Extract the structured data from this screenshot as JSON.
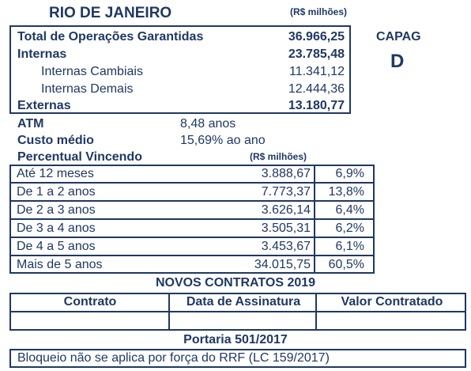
{
  "header": {
    "title": "RIO DE JANEIRO",
    "unit": "(R$ milhões)"
  },
  "summary": {
    "rows": [
      {
        "label": "Total de Operações Garantidas",
        "value": "36.966,25"
      },
      {
        "label": "Internas",
        "value": "23.785,48"
      },
      {
        "label": "Internas Cambiais",
        "value": "11.341,12"
      },
      {
        "label": "Internas Demais",
        "value": "12.444,36"
      },
      {
        "label": "Externas",
        "value": "13.180,77"
      }
    ]
  },
  "capag": {
    "label": "CAPAG",
    "grade": "D"
  },
  "indicators": {
    "atm_label": "ATM",
    "atm_value": "8,48 anos",
    "cost_label": "Custo médio",
    "cost_value": "15,69% ao ano",
    "pct_label": "Percentual Vincendo",
    "pct_unit": "(R$ milhões)"
  },
  "maturity": {
    "rows": [
      {
        "label": "Até 12 meses",
        "value": "3.888,67",
        "pct": "6,9%"
      },
      {
        "label": "De 1 a 2 anos",
        "value": "7.773,37",
        "pct": "13,8%"
      },
      {
        "label": "De 2 a 3 anos",
        "value": "3.626,14",
        "pct": "6,4%"
      },
      {
        "label": "De 3 a 4 anos",
        "value": "3.505,31",
        "pct": "6,2%"
      },
      {
        "label": "De 4 a 5 anos",
        "value": "3.453,67",
        "pct": "6,1%"
      },
      {
        "label": "Mais de 5 anos",
        "value": "34.015,75",
        "pct": "60,5%"
      }
    ]
  },
  "contracts": {
    "title": "NOVOS CONTRATOS 2019",
    "col_contract": "Contrato",
    "col_date": "Data de Assinatura",
    "col_value": "Valor Contratado"
  },
  "portaria": {
    "title": "Portaria 501/2017",
    "text": "Bloqueio não se aplica por força do RRF (LC 159/2017)"
  },
  "colors": {
    "text": "#1f3864",
    "border": "#1f3864"
  }
}
